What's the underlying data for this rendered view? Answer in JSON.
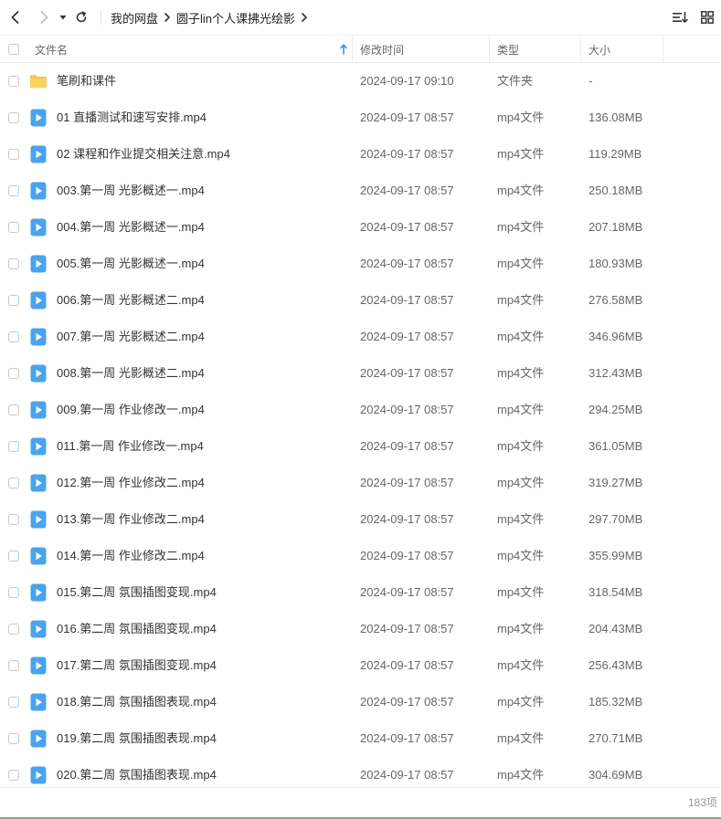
{
  "breadcrumb": [
    "我的网盘",
    "圆子lin个人课拂光绘影"
  ],
  "columns": {
    "name": "文件名",
    "modified": "修改时间",
    "type": "类型",
    "size": "大小"
  },
  "files": [
    {
      "name": "笔刷和课件",
      "date": "2024-09-17 09:10",
      "type": "文件夹",
      "size": "-",
      "kind": "folder"
    },
    {
      "name": "01  直播测试和速写安排.mp4",
      "date": "2024-09-17 08:57",
      "type": "mp4文件",
      "size": "136.08MB",
      "kind": "video"
    },
    {
      "name": "02  课程和作业提交相关注意.mp4",
      "date": "2024-09-17 08:57",
      "type": "mp4文件",
      "size": "119.29MB",
      "kind": "video"
    },
    {
      "name": "003.第一周 光影概述一.mp4",
      "date": "2024-09-17 08:57",
      "type": "mp4文件",
      "size": "250.18MB",
      "kind": "video"
    },
    {
      "name": "004.第一周 光影概述一.mp4",
      "date": "2024-09-17 08:57",
      "type": "mp4文件",
      "size": "207.18MB",
      "kind": "video"
    },
    {
      "name": "005.第一周 光影概述一.mp4",
      "date": "2024-09-17 08:57",
      "type": "mp4文件",
      "size": "180.93MB",
      "kind": "video"
    },
    {
      "name": "006.第一周 光影概述二.mp4",
      "date": "2024-09-17 08:57",
      "type": "mp4文件",
      "size": "276.58MB",
      "kind": "video"
    },
    {
      "name": "007.第一周 光影概述二.mp4",
      "date": "2024-09-17 08:57",
      "type": "mp4文件",
      "size": "346.96MB",
      "kind": "video"
    },
    {
      "name": "008.第一周 光影概述二.mp4",
      "date": "2024-09-17 08:57",
      "type": "mp4文件",
      "size": "312.43MB",
      "kind": "video"
    },
    {
      "name": "009.第一周 作业修改一.mp4",
      "date": "2024-09-17 08:57",
      "type": "mp4文件",
      "size": "294.25MB",
      "kind": "video"
    },
    {
      "name": "011.第一周 作业修改一.mp4",
      "date": "2024-09-17 08:57",
      "type": "mp4文件",
      "size": "361.05MB",
      "kind": "video"
    },
    {
      "name": "012.第一周 作业修改二.mp4",
      "date": "2024-09-17 08:57",
      "type": "mp4文件",
      "size": "319.27MB",
      "kind": "video"
    },
    {
      "name": "013.第一周 作业修改二.mp4",
      "date": "2024-09-17 08:57",
      "type": "mp4文件",
      "size": "297.70MB",
      "kind": "video"
    },
    {
      "name": "014.第一周 作业修改二.mp4",
      "date": "2024-09-17 08:57",
      "type": "mp4文件",
      "size": "355.99MB",
      "kind": "video"
    },
    {
      "name": "015.第二周 氛围插图变现.mp4",
      "date": "2024-09-17 08:57",
      "type": "mp4文件",
      "size": "318.54MB",
      "kind": "video"
    },
    {
      "name": "016.第二周 氛围插图变现.mp4",
      "date": "2024-09-17 08:57",
      "type": "mp4文件",
      "size": "204.43MB",
      "kind": "video"
    },
    {
      "name": "017.第二周 氛围插图变现.mp4",
      "date": "2024-09-17 08:57",
      "type": "mp4文件",
      "size": "256.43MB",
      "kind": "video"
    },
    {
      "name": "018.第二周 氛围插图表现.mp4",
      "date": "2024-09-17 08:57",
      "type": "mp4文件",
      "size": "185.32MB",
      "kind": "video"
    },
    {
      "name": "019.第二周 氛围插图表现.mp4",
      "date": "2024-09-17 08:57",
      "type": "mp4文件",
      "size": "270.71MB",
      "kind": "video"
    },
    {
      "name": "020.第二周 氛围插图表现.mp4",
      "date": "2024-09-17 08:57",
      "type": "mp4文件",
      "size": "304.69MB",
      "kind": "video"
    }
  ],
  "footer": {
    "count": "183项"
  },
  "colors": {
    "folder": "#f8c64a",
    "video": "#4aa3ef",
    "sort_arrow": "#3b8ff0"
  },
  "icons": {
    "back": "chevron-left-icon",
    "forward": "chevron-right-icon",
    "history": "caret-down-icon",
    "refresh": "refresh-icon",
    "sort": "sort-list-icon",
    "view": "grid-view-icon"
  }
}
